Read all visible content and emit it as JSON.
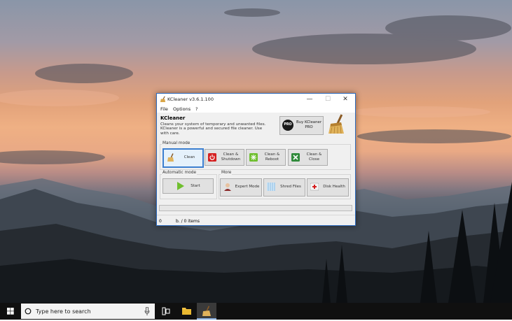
{
  "window": {
    "title": "KCleaner v3.6.1.100",
    "controls": {
      "minimize": "—",
      "maximize": "☐",
      "close": "✕"
    }
  },
  "menu": {
    "items": [
      "File",
      "Options",
      "?"
    ]
  },
  "header": {
    "app_name": "KCleaner",
    "description": "Cleans your system of temporary and unwanted files. KCleaner is a powerful and secured file cleaner. Use with care.",
    "buy_badge": "PRO",
    "buy_label": "Buy KCleaner PRO"
  },
  "manual_mode": {
    "label": "Manual mode",
    "buttons": [
      {
        "label": "Clean"
      },
      {
        "label": "Clean & Shutdown"
      },
      {
        "label": "Clean & Reboot"
      },
      {
        "label": "Clean & Close"
      }
    ]
  },
  "automatic_mode": {
    "label": "Automatic mode",
    "start_label": "Start"
  },
  "more": {
    "label": "More",
    "buttons": [
      {
        "label": "Expert Mode"
      },
      {
        "label": "Shred Files"
      },
      {
        "label": "Disk Health"
      }
    ]
  },
  "status": {
    "progress": 0,
    "left": "0",
    "right": "b. / 0 items"
  },
  "taskbar": {
    "search_placeholder": "Type here to search"
  },
  "colors": {
    "window_border": "#2d6cc0",
    "selected_border": "#3c7fd0",
    "taskbar": "#101010"
  }
}
